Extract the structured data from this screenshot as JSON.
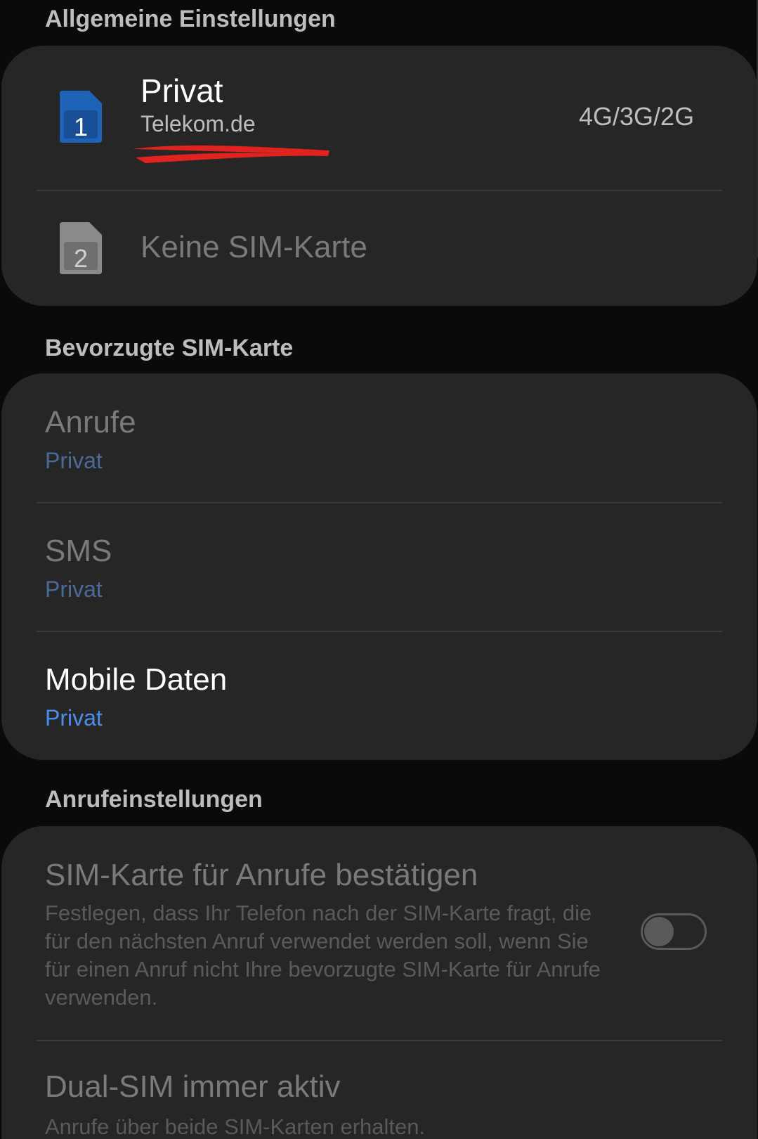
{
  "general": {
    "header": "Allgemeine Einstellungen",
    "sim1": {
      "number_badge": "1",
      "name": "Privat",
      "carrier": "Telekom.de",
      "network": "4G/3G/2G",
      "badge_color": "#1e63b8"
    },
    "sim2": {
      "number_badge": "2",
      "label": "Keine SIM-Karte",
      "badge_color": "#8a8a8a"
    }
  },
  "preferred": {
    "header": "Bevorzugte SIM-Karte",
    "calls": {
      "title": "Anrufe",
      "value": "Privat"
    },
    "sms": {
      "title": "SMS",
      "value": "Privat"
    },
    "mobile_data": {
      "title": "Mobile Daten",
      "value": "Privat"
    }
  },
  "call_settings": {
    "header": "Anrufeinstellungen",
    "confirm_sim": {
      "title": "SIM-Karte für Anrufe bestätigen",
      "description": "Festlegen, dass Ihr Telefon nach der SIM-Karte fragt, die für den nächsten Anruf verwendet werden soll, wenn Sie für einen Anruf nicht Ihre bevorzugte SIM-Karte für Anrufe verwenden.",
      "enabled": false
    },
    "dual_sim": {
      "title": "Dual-SIM immer aktiv",
      "description": "Anrufe über beide SIM-Karten erhalten."
    }
  },
  "colors": {
    "background": "#0a0a0a",
    "card": "#262626",
    "accent_blue": "#4a8ff0",
    "muted_blue": "#4a6b98",
    "redaction": "#e0231e"
  }
}
